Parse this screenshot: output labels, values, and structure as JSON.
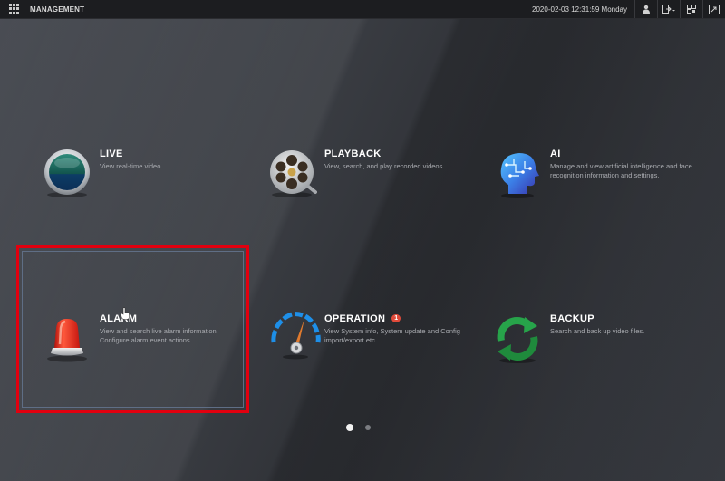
{
  "topbar": {
    "title": "MANAGEMENT",
    "datetime": "2020-02-03 12:31:59 Monday"
  },
  "tiles": [
    {
      "name": "LIVE",
      "desc": "View real-time video.",
      "icon": "live-icon"
    },
    {
      "name": "PLAYBACK",
      "desc": "View, search, and play recorded videos.",
      "icon": "film-reel-icon"
    },
    {
      "name": "AI",
      "desc": "Manage and view artificial intelligence and face recognition information and settings.",
      "icon": "ai-head-icon"
    },
    {
      "name": "ALARM",
      "desc": "View and search live alarm information. Configure alarm event actions.",
      "icon": "alarm-light-icon"
    },
    {
      "name": "OPERATION",
      "badge": "1",
      "desc": "View System info, System update and Config import/export etc.",
      "icon": "gauge-icon"
    },
    {
      "name": "BACKUP",
      "desc": "Search and back up video files.",
      "icon": "sync-arrows-icon"
    }
  ],
  "pagination": {
    "current": 1,
    "total": 2
  },
  "colors": {
    "highlight": "#e2000f",
    "badge": "#e04a3a",
    "backup_green": "#27a34a",
    "gauge_blue": "#1e8fe8"
  }
}
